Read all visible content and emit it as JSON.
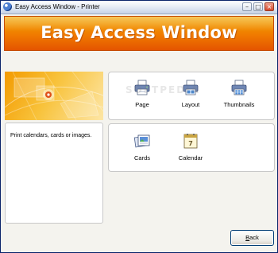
{
  "window": {
    "title": "Easy Access Window - Printer"
  },
  "banner": {
    "title": "Easy Access Window"
  },
  "description": "Print calendars, cards or images.",
  "print_options": [
    {
      "label": "Page",
      "icon": "printer-page-icon"
    },
    {
      "label": "Layout",
      "icon": "printer-layout-icon"
    },
    {
      "label": "Thumbnails",
      "icon": "printer-thumbnails-icon"
    }
  ],
  "print_projects": [
    {
      "label": "Cards",
      "icon": "cards-icon"
    },
    {
      "label": "Calendar",
      "icon": "calendar-icon"
    }
  ],
  "buttons": {
    "back": {
      "accel": "B",
      "rest": "ack"
    }
  },
  "watermark": "SOFTPEDIA",
  "colors": {
    "banner_orange": "#f07a00",
    "banner_text": "#ffffff",
    "title_bar": "#dfe6f2"
  }
}
